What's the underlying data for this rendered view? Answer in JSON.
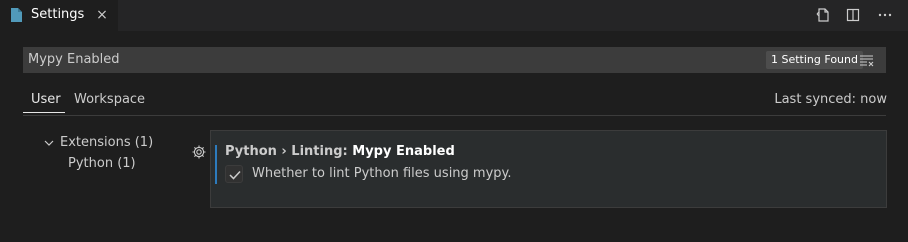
{
  "tab": {
    "label": "Settings",
    "icon": "settings-file-icon",
    "close": "×"
  },
  "actions": [
    "open-settings-json-icon",
    "split-editor-icon",
    "more-actions-icon"
  ],
  "search": {
    "value": "Mypy Enabled",
    "results_badge": "1 Setting Found",
    "filter_icon": "clear-filter-icon"
  },
  "scopes": {
    "user": "User",
    "workspace": "Workspace",
    "active": "User"
  },
  "sync_status": "Last synced: now",
  "tree": {
    "extensions": "Extensions (1)",
    "python": "Python (1)"
  },
  "setting": {
    "category": "Python › Linting: ",
    "name": "Mypy Enabled",
    "description": "Whether to lint Python files using mypy.",
    "checked": true
  },
  "colors": {
    "accent": "#2d7bbd",
    "file_icon": "#519aba"
  }
}
